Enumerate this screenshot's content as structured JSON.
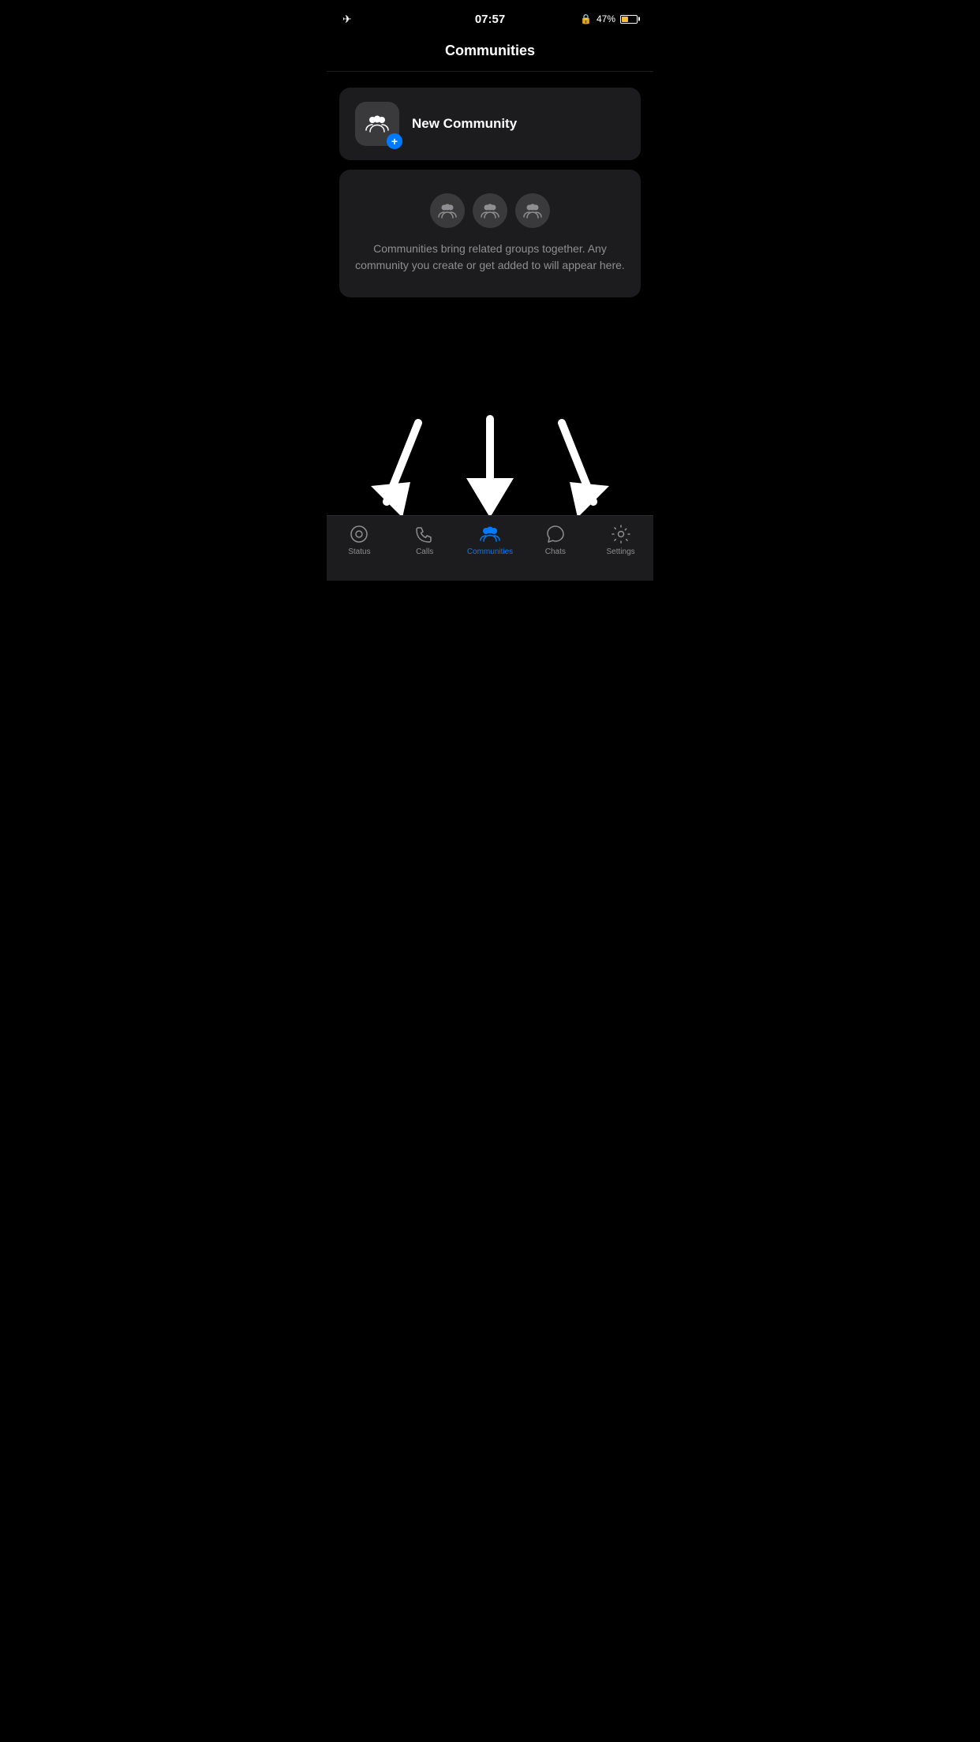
{
  "statusBar": {
    "time": "07:57",
    "batteryPercent": "47%",
    "showAirplane": true
  },
  "header": {
    "title": "Communities"
  },
  "newCommunity": {
    "label": "New Community"
  },
  "infoCard": {
    "text": "Communities bring related groups together. Any community you create or get added to will appear here."
  },
  "tabBar": {
    "items": [
      {
        "id": "status",
        "label": "Status",
        "active": false
      },
      {
        "id": "calls",
        "label": "Calls",
        "active": false
      },
      {
        "id": "communities",
        "label": "Communities",
        "active": true
      },
      {
        "id": "chats",
        "label": "Chats",
        "active": false
      },
      {
        "id": "settings",
        "label": "Settings",
        "active": false
      }
    ]
  },
  "arrows": {
    "count": 3
  }
}
